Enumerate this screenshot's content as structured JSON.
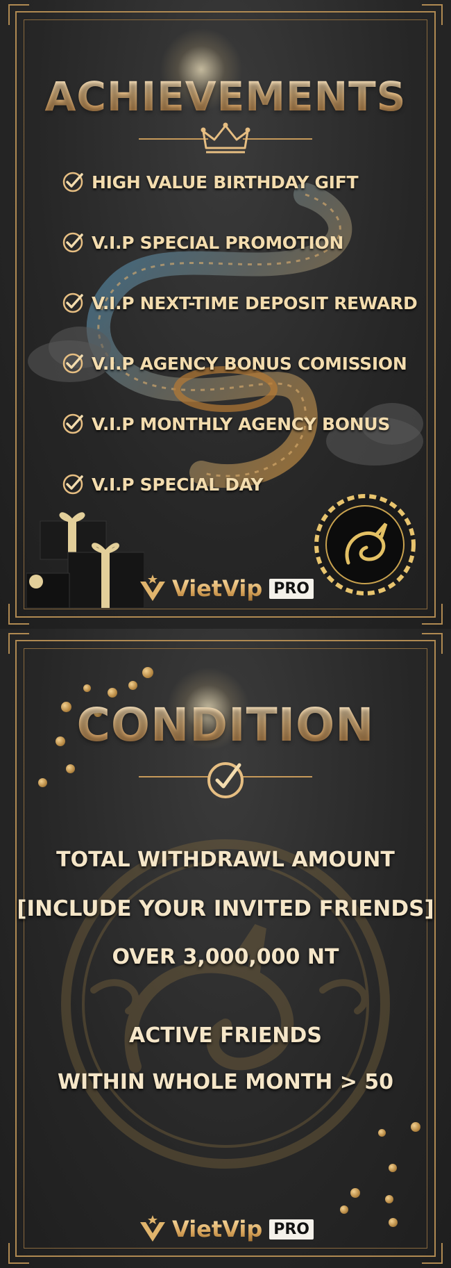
{
  "colors": {
    "gold": "#d9a65d",
    "gold_light": "#f3dcae",
    "background": "#262626",
    "frame": "#b08a52"
  },
  "achievements": {
    "title": "ACHIEVEMENTS",
    "icon": "crown-icon",
    "items": [
      "HIGH VALUE BIRTHDAY GIFT",
      "V.I.P SPECIAL PROMOTION",
      "V.I.P NEXT-TIME DEPOSIT REWARD",
      "V.I.P AGENCY BONUS COMISSION",
      "V.I.P MONTHLY AGENCY BONUS",
      "V.I.P SPECIAL DAY"
    ],
    "logo_brand": "VietVip",
    "logo_badge": "PRO"
  },
  "condition": {
    "title": "CONDITION",
    "icon": "check-circle-icon",
    "lines": [
      "TOTAL WITHDRAWL AMOUNT",
      "[INCLUDE YOUR INVITED FRIENDS]",
      "OVER 3,000,000 NT",
      "ACTIVE FRIENDS",
      "WITHIN WHOLE MONTH > 50"
    ],
    "logo_brand": "VietVip",
    "logo_badge": "PRO"
  }
}
